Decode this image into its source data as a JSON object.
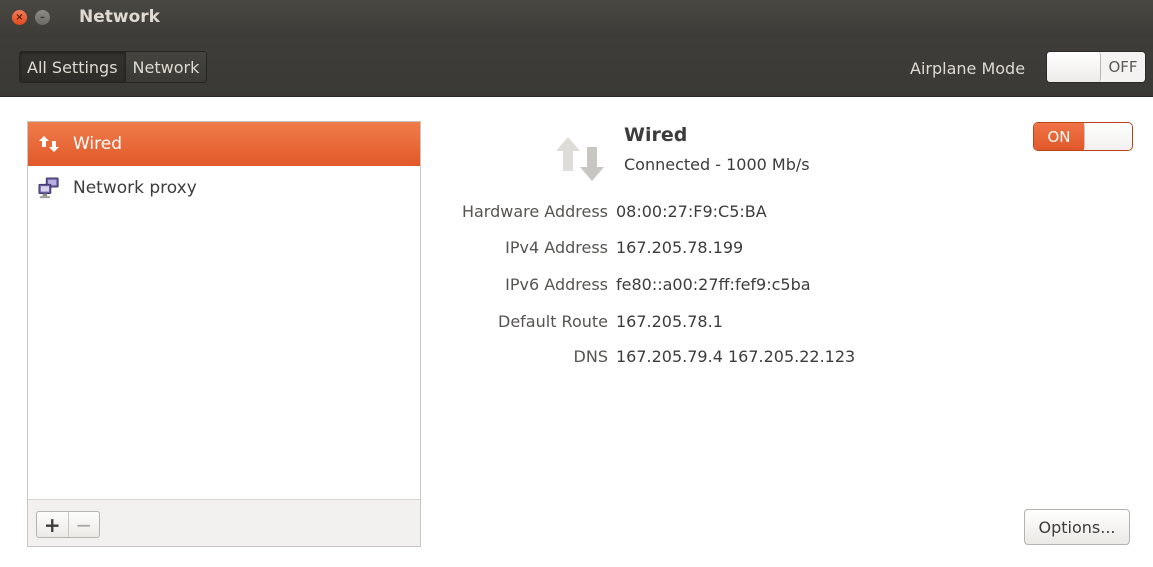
{
  "window": {
    "title": "Network",
    "close_glyph": "×",
    "minimize_glyph": "–"
  },
  "toolbar": {
    "crumbs": [
      "All Settings",
      "Network"
    ],
    "airplane_label": "Airplane Mode",
    "airplane_state": "OFF"
  },
  "sidebar": {
    "items": [
      {
        "label": "Wired",
        "icon": "network-transmit-receive-icon",
        "selected": true
      },
      {
        "label": "Network proxy",
        "icon": "network-proxy-icon",
        "selected": false
      }
    ],
    "add_label": "+",
    "remove_label": "−"
  },
  "detail": {
    "name": "Wired",
    "status": "Connected - 1000 Mb/s",
    "toggle_state": "ON",
    "rows": [
      {
        "key": "Hardware Address",
        "value": "08:00:27:F9:C5:BA"
      },
      {
        "key": "IPv4 Address",
        "value": "167.205.78.199"
      },
      {
        "key": "IPv6 Address",
        "value": "fe80::a00:27ff:fef9:c5ba"
      },
      {
        "key": "Default Route",
        "value": "167.205.78.1"
      },
      {
        "key": "DNS",
        "value": "167.205.79.4 167.205.22.123"
      }
    ],
    "options_label": "Options..."
  },
  "colors": {
    "accent": "#e95420",
    "titlebar": "#3c3b37",
    "text": "#3c3c3c"
  }
}
